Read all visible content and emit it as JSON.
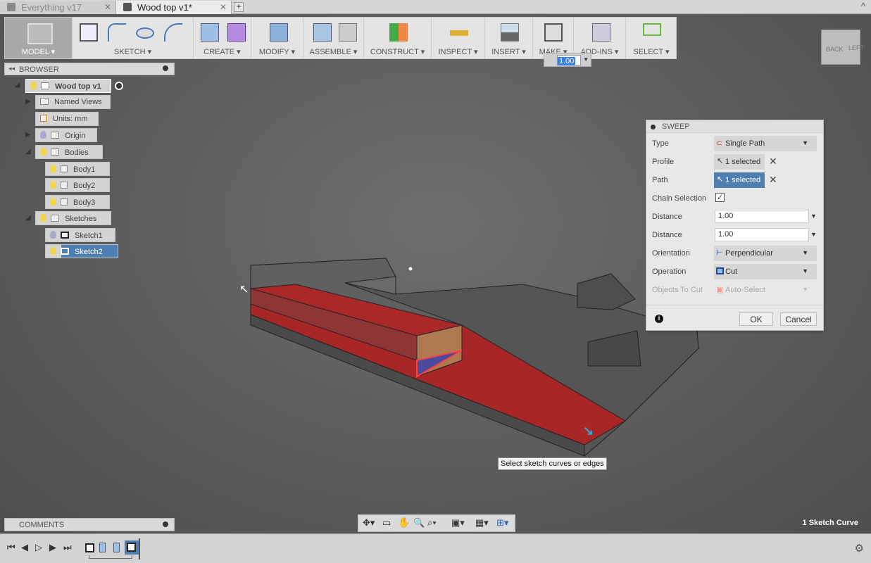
{
  "tabs": [
    {
      "label": "Everything v17",
      "active": false
    },
    {
      "label": "Wood top v1*",
      "active": true
    }
  ],
  "toolbar": {
    "model": "MODEL ▾",
    "groups": [
      "SKETCH ▾",
      "CREATE ▾",
      "MODIFY ▾",
      "ASSEMBLE ▾",
      "CONSTRUCT ▾",
      "INSPECT ▾",
      "INSERT ▾",
      "MAKE ▾",
      "ADD-INS ▾",
      "SELECT ▾"
    ]
  },
  "floating_input": {
    "value": "1.00"
  },
  "viewcube": {
    "back": "BACK",
    "left": "LEFT"
  },
  "browser": {
    "title": "BROWSER",
    "items": [
      {
        "label": "Wood top v1",
        "level": 0
      },
      {
        "label": "Named Views",
        "level": 1
      },
      {
        "label": "Units: mm",
        "level": 1
      },
      {
        "label": "Origin",
        "level": 1
      },
      {
        "label": "Bodies",
        "level": 1
      },
      {
        "label": "Body1",
        "level": 2
      },
      {
        "label": "Body2",
        "level": 2
      },
      {
        "label": "Body3",
        "level": 2
      },
      {
        "label": "Sketches",
        "level": 1
      },
      {
        "label": "Sketch1",
        "level": 2
      },
      {
        "label": "Sketch2",
        "level": 2,
        "selected": true
      }
    ]
  },
  "sweep": {
    "title": "SWEEP",
    "rows": [
      {
        "label": "Type",
        "value": "Single Path"
      },
      {
        "label": "Profile",
        "value": "1 selected"
      },
      {
        "label": "Path",
        "value": "1 selected"
      },
      {
        "label": "Chain Selection",
        "checked": true
      },
      {
        "label": "Distance",
        "value": "1.00"
      },
      {
        "label": "Distance",
        "value": "1.00"
      },
      {
        "label": "Orientation",
        "value": "Perpendicular"
      },
      {
        "label": "Operation",
        "value": "Cut"
      },
      {
        "label": "Objects To Cut",
        "value": "Auto-Select"
      }
    ],
    "ok": "OK",
    "cancel": "Cancel"
  },
  "tooltip": "Select sketch curves or edges",
  "comments": {
    "title": "COMMENTS"
  },
  "status": "1 Sketch Curve",
  "colors": {
    "selection": "#4f7fb0",
    "cut": "#b81e1e"
  }
}
